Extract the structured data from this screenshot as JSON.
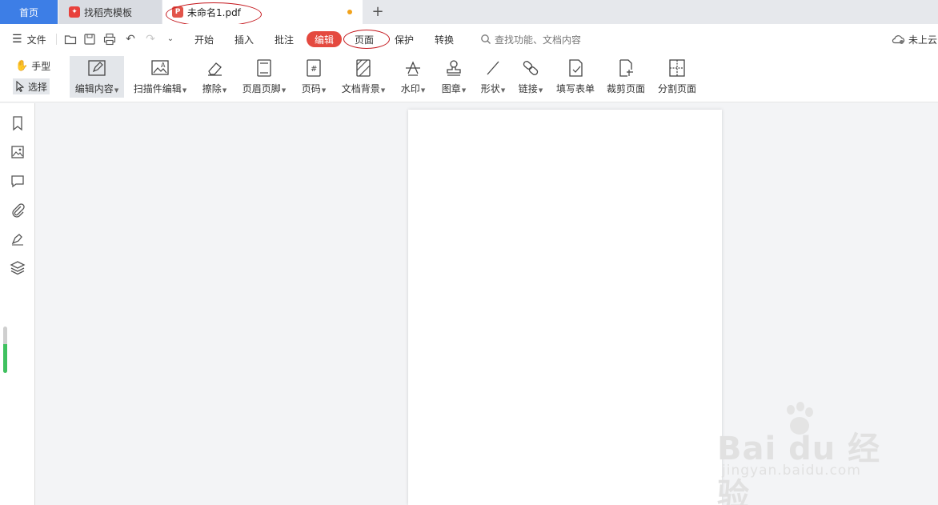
{
  "tabs": {
    "home": "首页",
    "template": "找稻壳模板",
    "doc": "未命名1.pdf",
    "new_tab": "+"
  },
  "menu": {
    "file": "文件",
    "items": [
      "开始",
      "插入",
      "批注",
      "编辑",
      "页面",
      "保护",
      "转换"
    ],
    "active_index": 3,
    "search_placeholder": "查找功能、文档内容",
    "cloud": "未上云"
  },
  "ribbon": {
    "hand": "手型",
    "select": "选择",
    "tools": [
      {
        "label": "编辑内容",
        "dropdown": true,
        "icon": "edit-content-icon"
      },
      {
        "label": "扫描件编辑",
        "dropdown": true,
        "icon": "scan-edit-icon"
      },
      {
        "label": "擦除",
        "dropdown": true,
        "icon": "eraser-icon"
      },
      {
        "label": "页眉页脚",
        "dropdown": true,
        "icon": "header-footer-icon"
      },
      {
        "label": "页码",
        "dropdown": true,
        "icon": "page-number-icon"
      },
      {
        "label": "文档背景",
        "dropdown": true,
        "icon": "background-icon"
      },
      {
        "label": "水印",
        "dropdown": true,
        "icon": "watermark-icon"
      },
      {
        "label": "图章",
        "dropdown": true,
        "icon": "stamp-icon"
      },
      {
        "label": "形状",
        "dropdown": true,
        "icon": "shape-icon"
      },
      {
        "label": "链接",
        "dropdown": true,
        "icon": "link-icon"
      },
      {
        "label": "填写表单",
        "dropdown": false,
        "icon": "fill-form-icon"
      },
      {
        "label": "裁剪页面",
        "dropdown": false,
        "icon": "crop-page-icon"
      },
      {
        "label": "分割页面",
        "dropdown": false,
        "icon": "split-page-icon"
      }
    ]
  },
  "sidebar": {
    "icons": [
      "bookmark-icon",
      "image-icon",
      "comment-icon",
      "attachment-icon",
      "signature-icon",
      "layers-icon"
    ],
    "scroll_fill": 0.62
  },
  "watermark": {
    "main": "Bai du 经验",
    "sub": "jingyan.baidu.com"
  },
  "colors": {
    "accent_blue": "#3d7ee6",
    "active_red": "#e4493f",
    "annotation_red": "#c4161c",
    "modified_dot": "#f2a21b",
    "scroll_green": "#3fc15f"
  }
}
